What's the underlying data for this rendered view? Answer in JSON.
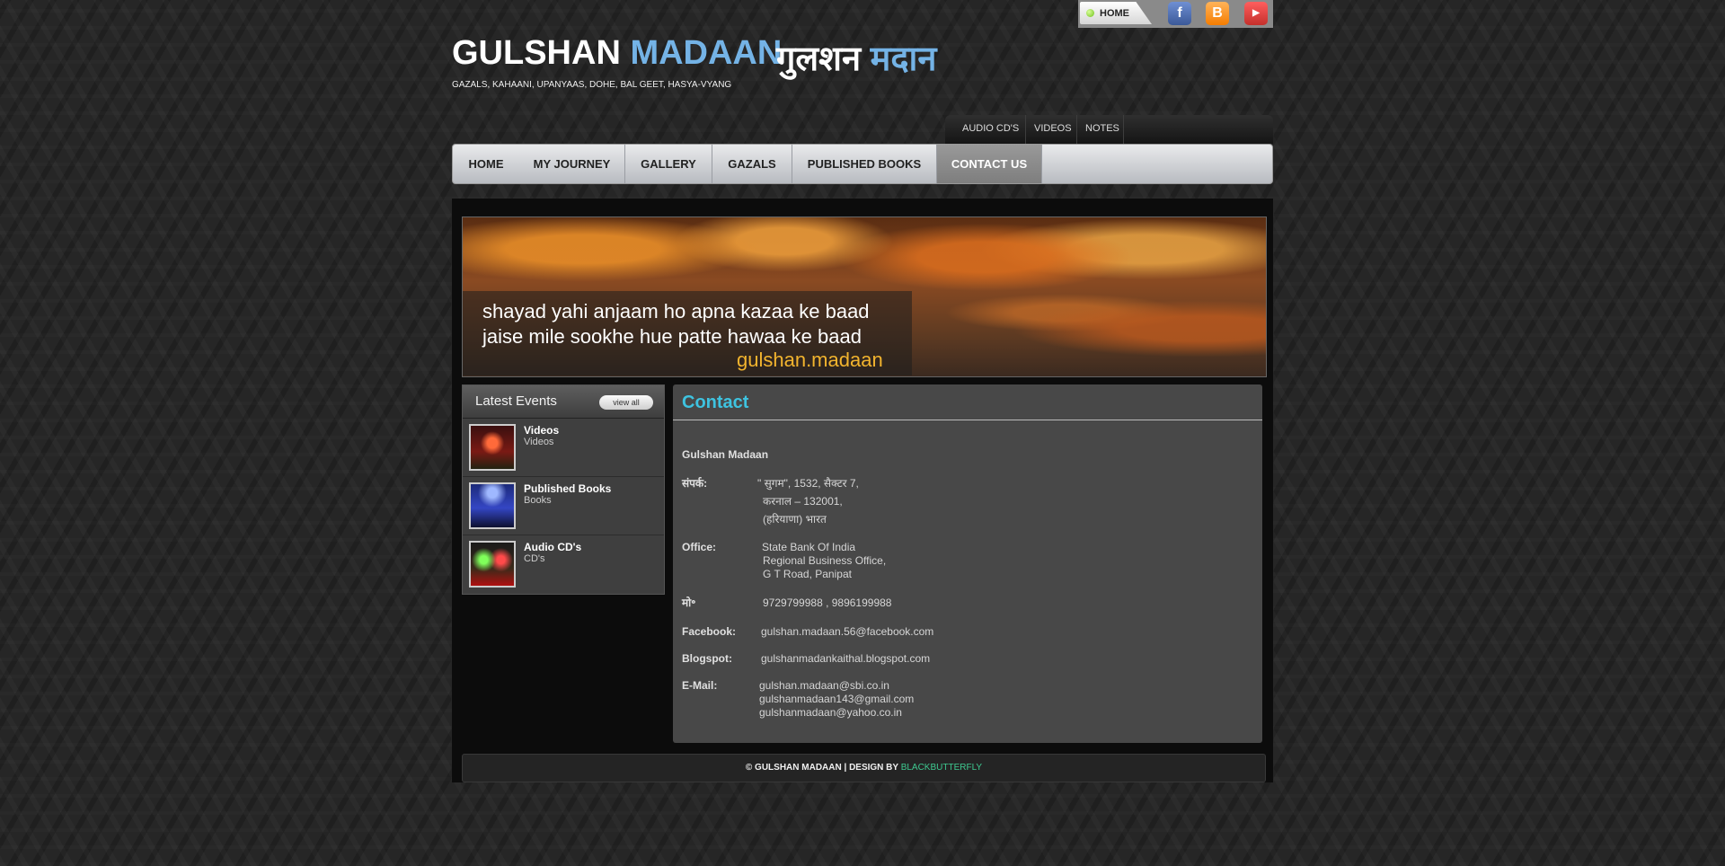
{
  "topbar": {
    "home_label": "HOME",
    "facebook_icon": "facebook-icon",
    "blogger_icon": "blogger-icon",
    "youtube_icon": "youtube-icon"
  },
  "brand": {
    "name_first": "GULSHAN",
    "name_last": "MADAAN",
    "hindi_first": "गुलशन",
    "hindi_last": "मदान",
    "tagline": "GAZALS, KAHAANI, UPANYAAS, DOHE, BAL GEET, HASYA-VYANG",
    "accent_color": "#74b3e6"
  },
  "subnav": {
    "items": [
      "AUDIO CD'S",
      "VIDEOS",
      "NOTES"
    ]
  },
  "mainnav": {
    "items": [
      "HOME",
      "MY JOURNEY",
      "GALLERY",
      "GAZALS",
      "PUBLISHED BOOKS",
      "CONTACT US"
    ],
    "active": "CONTACT US"
  },
  "banner": {
    "line1": "shayad yahi anjaam ho apna kazaa ke baad",
    "line2": "jaise mile sookhe hue patte hawaa ke baad",
    "signature": "gulshan.madaan"
  },
  "events": {
    "title": "Latest Events",
    "view_all": "view all",
    "items": [
      {
        "title": "Videos",
        "subtitle": "Videos"
      },
      {
        "title": "Published Books",
        "subtitle": "Books"
      },
      {
        "title": "Audio CD's",
        "subtitle": "CD's"
      }
    ]
  },
  "contact": {
    "title": "Contact",
    "name": "Gulshan Madaan",
    "address_label": "संपर्क:",
    "address_lines": [
      "\" सुगम\", 1532, सैक्टर 7,",
      "करनाल – 132001,",
      "(हरियाणा) भारत"
    ],
    "office_label": "Office:",
    "office_lines": [
      "State Bank Of India",
      "Regional Business Office,",
      "G T Road, Panipat"
    ],
    "mobile_label": "मो॰",
    "mobile": "9729799988 , 9896199988",
    "facebook_label": "Facebook:",
    "facebook": "gulshan.madaan.56@facebook.com",
    "blogspot_label": "Blogspot:",
    "blogspot": "gulshanmadankaithal.blogspot.com",
    "email_label": "E-Mail:",
    "emails": [
      "gulshan.madaan@sbi.co.in",
      "gulshanmadaan143@gmail.com",
      "gulshanmadaan@yahoo.co.in"
    ],
    "title_color": "#3ec3e0"
  },
  "footer": {
    "text": "© GULSHAN MADAAN | DESIGN BY",
    "link": "BLACKBUTTERFLY",
    "link_color": "#3ec990"
  }
}
